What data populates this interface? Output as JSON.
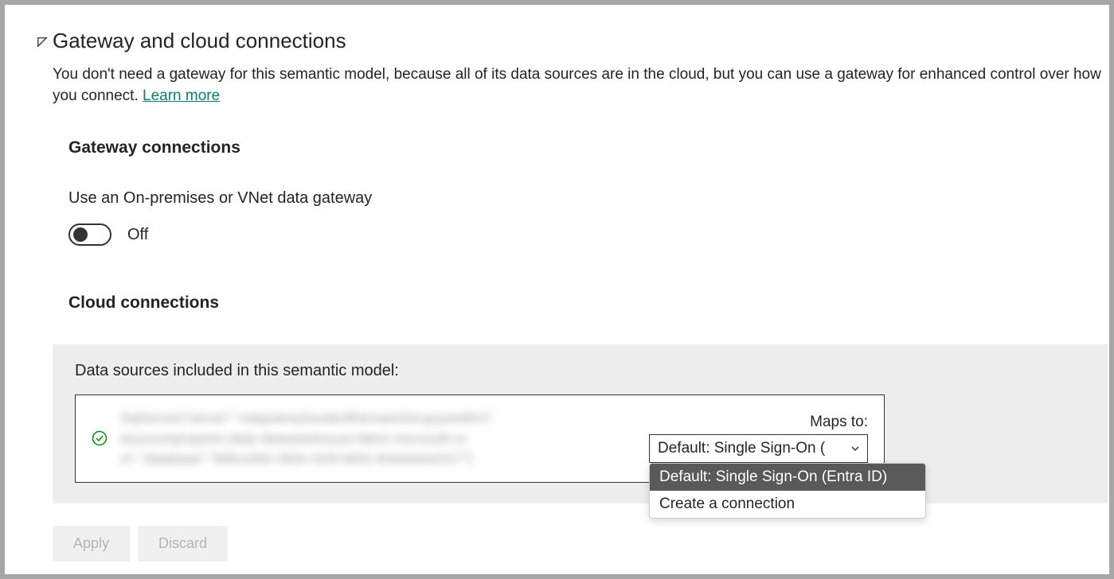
{
  "header": {
    "title": "Gateway and cloud connections",
    "description": "You don't need a gateway for this semantic model, because all of its data sources are in the cloud, but you can use a gateway for enhanced control over how you connect.",
    "learn_more": "Learn more"
  },
  "gateway": {
    "title": "Gateway connections",
    "toggle_label": "Use an On-premises or VNet data gateway",
    "toggle_state": "Off"
  },
  "cloud": {
    "title": "Cloud connections",
    "panel_title": "Data sources included in this semantic model:",
    "maps_label": "Maps to:",
    "selected_value": "Default: Single Sign-On (",
    "options": [
      "Default: Single Sign-On (Entra ID)",
      "Create a connection"
    ]
  },
  "buttons": {
    "apply": "Apply",
    "discard": "Discard"
  }
}
